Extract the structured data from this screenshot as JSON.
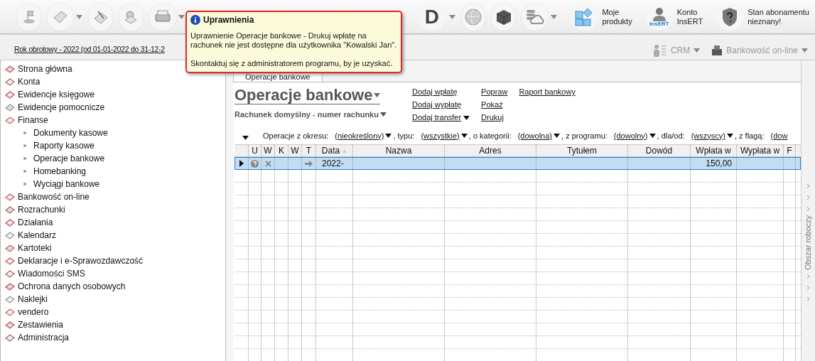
{
  "toolbar": {
    "letter_button": "D",
    "labeled_buttons": [
      {
        "kind": "products",
        "lines": [
          "Moje",
          "produkty"
        ]
      },
      {
        "kind": "account",
        "lines": [
          "Konto",
          "InsERT"
        ],
        "badge": "InsERT"
      },
      {
        "kind": "subscription",
        "lines": [
          "Stan abonamentu",
          "nieznany!"
        ]
      }
    ]
  },
  "fiscal_year": "Rok obrotowy - 2022 (od 01-01-2022 do 31-12-2",
  "modules": [
    {
      "kind": "crm",
      "label": "CRM"
    },
    {
      "kind": "bank",
      "label": "Bankowość on-line"
    }
  ],
  "sidebar": {
    "items": [
      {
        "label": "Strona główna"
      },
      {
        "label": "Konta"
      },
      {
        "label": "Ewidencje księgowe"
      },
      {
        "label": "Ewidencje pomocnicze"
      },
      {
        "label": "Finanse",
        "children": [
          {
            "label": "Dokumenty kasowe"
          },
          {
            "label": "Raporty kasowe"
          },
          {
            "label": "Operacje bankowe"
          },
          {
            "label": "Homebanking"
          },
          {
            "label": "Wyciągi bankowe"
          }
        ]
      },
      {
        "label": "Bankowość on-line"
      },
      {
        "label": "Rozrachunki"
      },
      {
        "label": "Działania"
      },
      {
        "label": "Kalendarz"
      },
      {
        "label": "Kartoteki"
      },
      {
        "label": "Deklaracje i e-Sprawozdawczość"
      },
      {
        "label": "Wiadomości SMS"
      },
      {
        "label": "Ochrona danych osobowych"
      },
      {
        "label": "Naklejki"
      },
      {
        "label": "vendero"
      },
      {
        "label": "Zestawienia"
      },
      {
        "label": "Administracja"
      }
    ]
  },
  "tab": {
    "label": "Operacje bankowe"
  },
  "page": {
    "title": "Operacje bankowe",
    "account": "Rachunek domyślny - numer rachunku",
    "actions": [
      [
        {
          "label": "Dodaj wpłatę",
          "dropdown": false
        },
        {
          "label": "Dodaj wypłatę",
          "dropdown": false
        },
        {
          "label": "Dodaj transfer",
          "dropdown": true
        }
      ],
      [
        {
          "label": "Popraw",
          "dropdown": false
        },
        {
          "label": "Pokaż",
          "dropdown": false
        },
        {
          "label": "Drukuj",
          "dropdown": false
        }
      ],
      [
        {
          "label": "Raport bankowy",
          "dropdown": false
        }
      ]
    ],
    "filters": [
      {
        "label": "Operacje z okresu:",
        "value": "(nieokreślony)",
        "dropdown": true
      },
      {
        "label": ", typu:",
        "value": "(wszystkie)",
        "dropdown": true
      },
      {
        "label": ", o kategorii:",
        "value": "(dowolna)",
        "dropdown": true
      },
      {
        "label": ", z programu:",
        "value": "(dowolny)",
        "dropdown": true
      },
      {
        "label": ", dla/od:",
        "value": "(wszyscy)",
        "dropdown": true
      },
      {
        "label": ", z flagą:",
        "value": "(dow",
        "dropdown": false
      }
    ]
  },
  "table": {
    "columns": [
      "U",
      "W",
      "K",
      "W",
      "T",
      "Data",
      "Nazwa",
      "Adres",
      "Tytułem",
      "Dowód",
      "Wpłata w",
      "Wypłata w",
      "F"
    ],
    "rows": [
      {
        "selected": true,
        "cells": [
          "",
          "",
          "",
          "",
          "",
          "2022-",
          "",
          "",
          "",
          "",
          "150,00",
          "",
          ""
        ]
      }
    ]
  },
  "workspace": {
    "label": "Obszar roboczy"
  },
  "tooltip": {
    "title": "Uprawnienia",
    "message": "Uprawnienie Operacje bankowe - Drukuj wpłatę na rachunek nie jest dostępne dla użytkownika \"Kowalski Jan\".",
    "hint": "Skontaktuj się z administratorem programu, by je uzyskać."
  }
}
